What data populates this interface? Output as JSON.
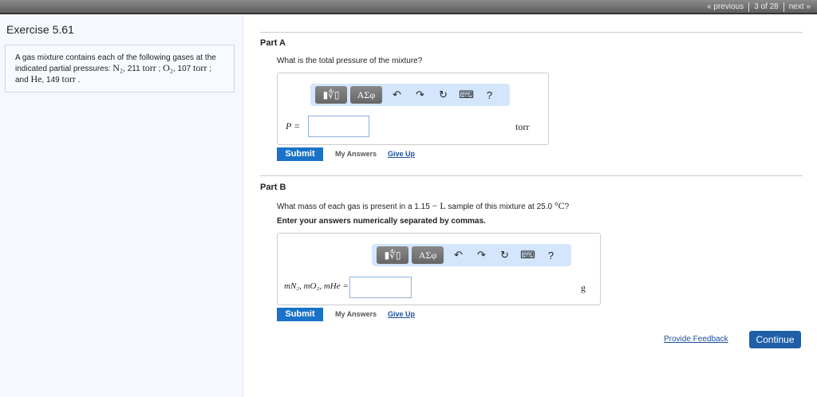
{
  "nav": {
    "previous": "« previous",
    "position": "3 of 28",
    "next": "next »"
  },
  "exercise": {
    "title": "Exercise 5.61",
    "problem": {
      "t1": "A gas mixture contains each of the following gases at the indicated partial pressures: ",
      "n2": "N₂",
      "t2": ", 211 ",
      "u": "torr",
      "t3": " ; ",
      "o2": "O₂",
      "t4": ", 107 ",
      "t5": " ; and ",
      "he": "He",
      "t6": ", 149 ",
      "t7": " ."
    }
  },
  "toolbar": {
    "templates": "▮∜▯",
    "greek": "ΑΣφ",
    "undo": "↶",
    "redo": "↷",
    "reset": "↻",
    "keyboard": "⌨",
    "help": "?"
  },
  "partA": {
    "title": "Part A",
    "question": "What is the total pressure of the mixture?",
    "label": "P =",
    "value": "",
    "unit": "torr",
    "submit": "Submit",
    "my_answers": "My Answers",
    "give_up": "Give Up"
  },
  "partB": {
    "title": "Part B",
    "q1": "What mass of each gas is present in a 1.15 ",
    "q_unit": "− L",
    "q2": " sample of this mixture at 25.0 ",
    "q_temp": "°C",
    "q3": "?",
    "instruction": "Enter your answers numerically separated by commas.",
    "label": "mN₂, mO₂, mHe =",
    "value": "",
    "unit": "g",
    "submit": "Submit",
    "my_answers": "My Answers",
    "give_up": "Give Up"
  },
  "footer": {
    "feedback": "Provide Feedback",
    "continue": "Continue"
  }
}
